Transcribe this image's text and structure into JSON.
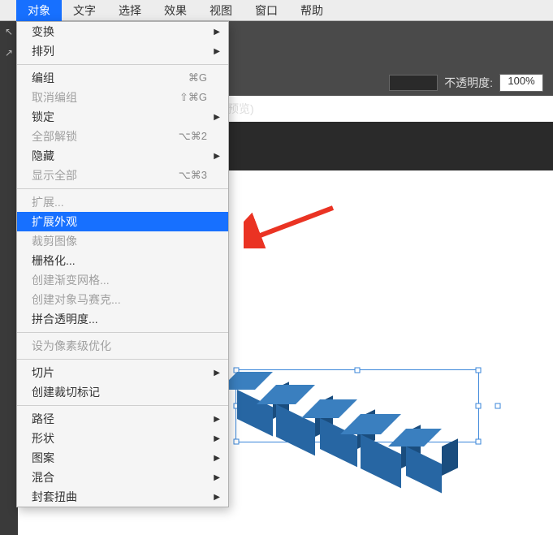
{
  "menubar": {
    "items": [
      "对象",
      "文字",
      "选择",
      "效果",
      "视图",
      "窗口",
      "帮助"
    ],
    "active_index": 0
  },
  "option_bar": {
    "opacity_label": "不透明度:",
    "opacity_value": "100%"
  },
  "preview_label": "预览)",
  "dropdown": {
    "groups": [
      [
        {
          "label": "变换",
          "submenu": true
        },
        {
          "label": "排列",
          "submenu": true
        }
      ],
      [
        {
          "label": "编组",
          "shortcut": "⌘G"
        },
        {
          "label": "取消编组",
          "shortcut": "⇧⌘G",
          "disabled": true
        },
        {
          "label": "锁定",
          "submenu": true
        },
        {
          "label": "全部解锁",
          "shortcut": "⌥⌘2",
          "disabled": true
        },
        {
          "label": "隐藏",
          "submenu": true
        },
        {
          "label": "显示全部",
          "shortcut": "⌥⌘3",
          "disabled": true
        }
      ],
      [
        {
          "label": "扩展...",
          "disabled": true
        },
        {
          "label": "扩展外观",
          "selected": true
        },
        {
          "label": "裁剪图像",
          "disabled": true
        },
        {
          "label": "栅格化..."
        },
        {
          "label": "创建渐变网格...",
          "disabled": true
        },
        {
          "label": "创建对象马赛克...",
          "disabled": true
        },
        {
          "label": "拼合透明度..."
        }
      ],
      [
        {
          "label": "设为像素级优化",
          "disabled": true
        }
      ],
      [
        {
          "label": "切片",
          "submenu": true
        },
        {
          "label": "创建裁切标记"
        }
      ],
      [
        {
          "label": "路径",
          "submenu": true
        },
        {
          "label": "形状",
          "submenu": true
        },
        {
          "label": "图案",
          "submenu": true
        },
        {
          "label": "混合",
          "submenu": true
        },
        {
          "label": "封套扭曲",
          "submenu": true
        }
      ]
    ]
  },
  "colors": {
    "highlight": "#1770ff",
    "arrow": "#ea3323",
    "cube_top": "#3a7fbf",
    "cube_front": "#2766a3",
    "cube_side": "#1a4d7e",
    "selection": "#3a86d9"
  }
}
